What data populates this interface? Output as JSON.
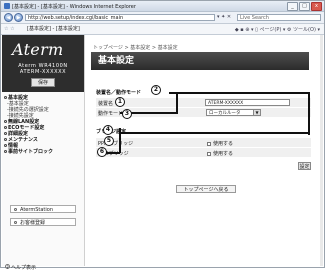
{
  "window": {
    "title": "[基本設定] - [基本設定] - Windows Internet Explorer",
    "minimize": "_",
    "maximize": "□",
    "close": "x"
  },
  "address_bar": {
    "back": "◀",
    "forward": "▶",
    "url": "http://web.setup/index.cgi/basic_main",
    "url_icons": "▾ ✦ ✕",
    "search_placeholder": "Live Search"
  },
  "tab_bar": {
    "favorites": "☆ ☆",
    "tab_label": "[基本設定] - [基本設定]",
    "tools": "◆ ▪ ⊕ ▾ ▯ ページ(P) ▾ ⚙ ツール(O) ▾"
  },
  "sidebar": {
    "brand": "Aterm",
    "model_line1": "Aterm WR4100N",
    "model_line2": "ATERM-XXXXXX",
    "save_button": "保存",
    "menu": [
      {
        "label": "基本設定",
        "type": "main"
      },
      {
        "label": "-基本設定",
        "type": "sub"
      },
      {
        "label": "-接続先の選択設定",
        "type": "sub"
      },
      {
        "label": "-接続先設定",
        "type": "sub"
      },
      {
        "label": "無線LAN設定",
        "type": "main"
      },
      {
        "label": "ECOモード設定",
        "type": "main"
      },
      {
        "label": "詳細設定",
        "type": "main"
      },
      {
        "label": "メンテナンス",
        "type": "main"
      },
      {
        "label": "情報",
        "type": "main"
      },
      {
        "label": "事前サイトブロック",
        "type": "main"
      }
    ],
    "atermstation_button": "AtermStation",
    "support_button": "お客様登録",
    "help": "ヘルプ表示"
  },
  "main": {
    "breadcrumb": "トップページ > 基本設定 > 基本設定",
    "page_title": "基本設定",
    "section1_title": "装置名／動作モード",
    "rows1": [
      {
        "label": "装置名",
        "value": "ATERM-XXXXXX"
      },
      {
        "label": "動作モード",
        "value": "ローカルルータ"
      }
    ],
    "section2_title": "ブリッジ設定",
    "rows2": [
      {
        "label": "PPPoEブリッジ",
        "checkbox": "使用する"
      },
      {
        "label": "IPv6ブリッジ",
        "checkbox": "使用する"
      }
    ],
    "set_button": "設定",
    "back_to_top": "トップページへ戻る",
    "callouts": [
      "2",
      "3",
      "1",
      "4",
      "5",
      "6"
    ]
  }
}
